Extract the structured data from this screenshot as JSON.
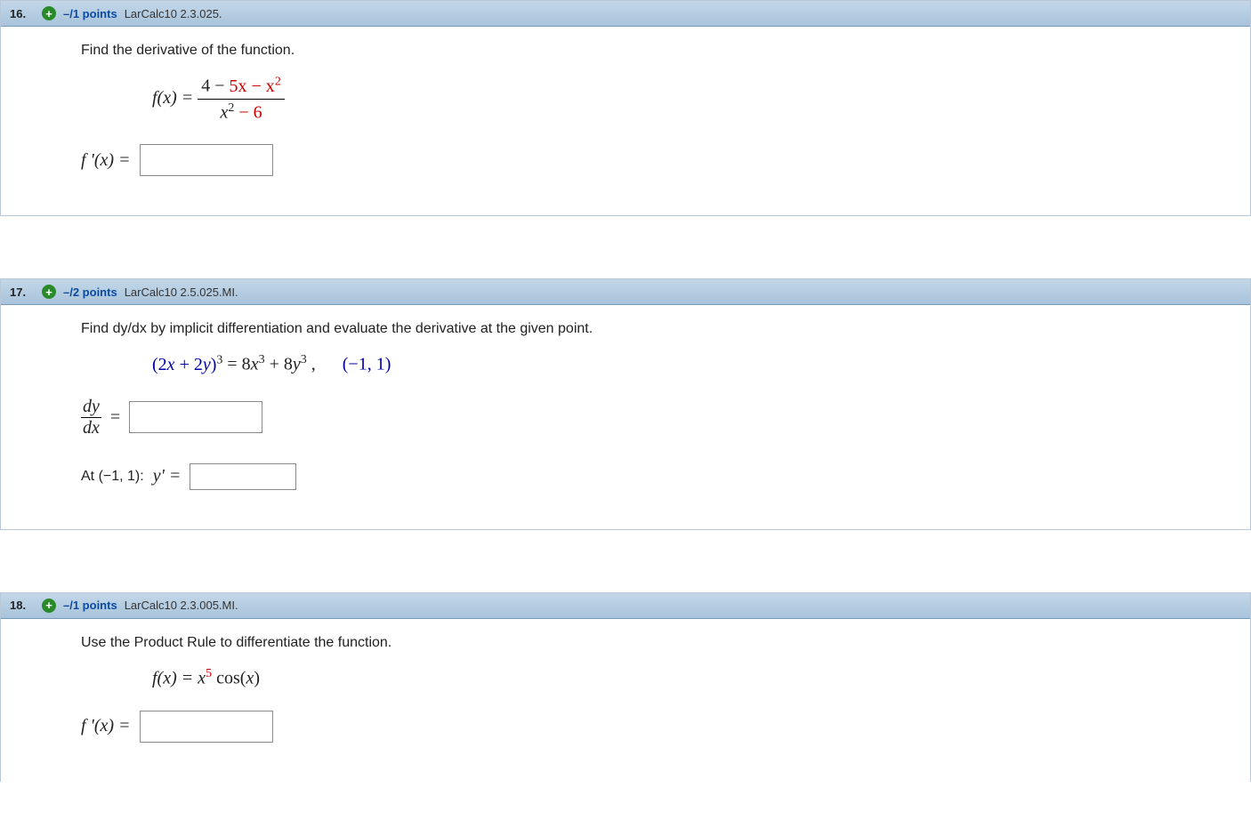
{
  "questions": [
    {
      "number": "16.",
      "points": "–/1 points",
      "reference": "LarCalc10 2.3.025.",
      "prompt": "Find the derivative of the function.",
      "fx_lhs": "f(x) = ",
      "numerator_pre": "4 − ",
      "numerator_red": "5x − x",
      "numerator_sup": "2",
      "denominator_x": "x",
      "denominator_sup": "2",
      "denominator_post": " − 6",
      "answer_label": "f '(x) = "
    },
    {
      "number": "17.",
      "points": "–/2 points",
      "reference": "LarCalc10 2.5.025.MI.",
      "prompt": "Find dy/dx by implicit differentiation and evaluate the derivative at the given point.",
      "equation_lhs": "(2x + 2y)",
      "equation_lhs_sup": "3",
      "equation_eq": " = 8",
      "equation_x": "x",
      "equation_x_sup": "3",
      "equation_plus": " + 8",
      "equation_y": "y",
      "equation_y_sup": "3",
      "equation_comma": " ,",
      "point": "(−1, 1)",
      "dy": "dy",
      "dx": "dx",
      "equals": " = ",
      "at_label_pre": "At (−1, 1): ",
      "at_label_y": "y' = "
    },
    {
      "number": "18.",
      "points": "–/1 points",
      "reference": "LarCalc10 2.3.005.MI.",
      "prompt": "Use the Product Rule to differentiate the function.",
      "fx_lhs": "f(x) = ",
      "fx_x": "x",
      "fx_sup": "5",
      "fx_cos": " cos(x)",
      "answer_label": "f '(x) = "
    }
  ]
}
